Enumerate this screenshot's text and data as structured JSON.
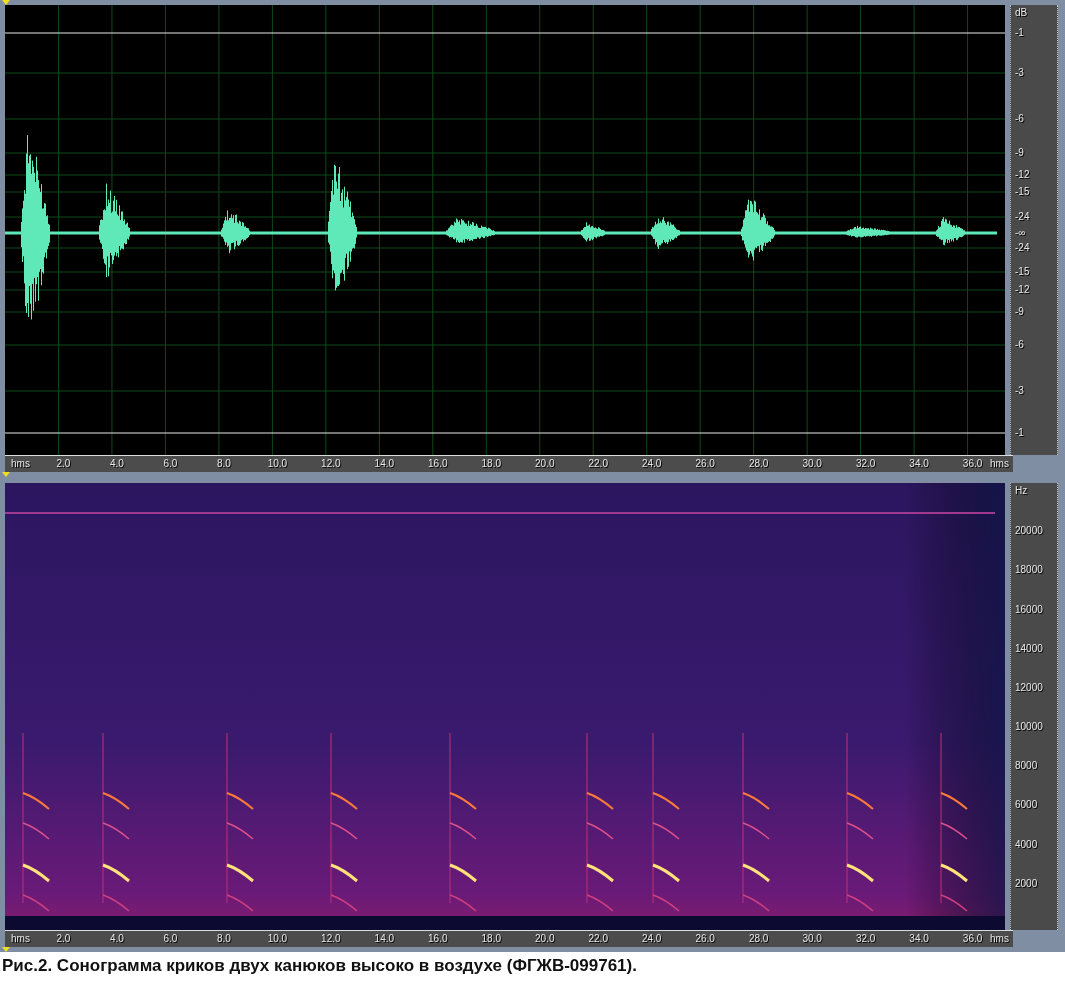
{
  "waveform_panel": {
    "amplitude_scale": {
      "unit": "dB",
      "labels": [
        "-1",
        "-3",
        "-6",
        "-9",
        "-12",
        "-15",
        "-24",
        "-∞",
        "-24",
        "-15",
        "-12",
        "-9",
        "-6",
        "-3",
        "-1"
      ]
    }
  },
  "waveform_time_ruler": {
    "start_label": "hms",
    "labels": [
      "2.0",
      "4.0",
      "6.0",
      "8.0",
      "10.0",
      "12.0",
      "14.0",
      "16.0",
      "18.0",
      "20.0",
      "22.0",
      "24.0",
      "26.0",
      "28.0",
      "30.0",
      "32.0",
      "34.0",
      "36.0"
    ],
    "end_label": "hms"
  },
  "spectrogram_panel": {
    "frequency_scale": {
      "unit": "Hz",
      "labels": [
        "20000",
        "18000",
        "16000",
        "14000",
        "12000",
        "10000",
        "8000",
        "6000",
        "4000",
        "2000"
      ]
    }
  },
  "spectrogram_time_ruler": {
    "start_label": "hms",
    "labels": [
      "2.0",
      "4.0",
      "6.0",
      "8.0",
      "10.0",
      "12.0",
      "14.0",
      "16.0",
      "18.0",
      "20.0",
      "22.0",
      "24.0",
      "26.0",
      "28.0",
      "30.0",
      "32.0",
      "34.0",
      "36.0"
    ],
    "end_label": "hms"
  },
  "caption": "Рис.2. Сонограмма криков двух канюков высоко в воздухе (ФГЖВ-099761)."
}
